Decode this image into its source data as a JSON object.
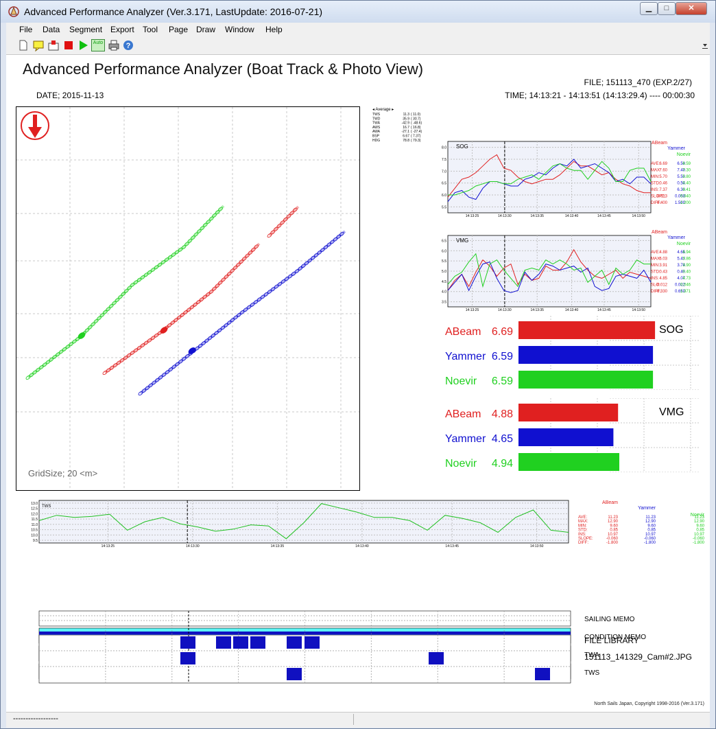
{
  "window": {
    "title": "Advanced Performance Analyzer (Ver.3.171, LastUpdate: 2016-07-21)",
    "minimize": "▁",
    "maximize": "□",
    "close": "✕"
  },
  "menu": [
    "File",
    "Data",
    "Segment",
    "Export",
    "Tool",
    "Page",
    "Draw",
    "Window",
    "Help"
  ],
  "toolbar": {
    "icons": [
      "new-file-icon",
      "memo-icon",
      "open-icon",
      "stop-icon",
      "play-icon",
      "auto-icon",
      "print-icon",
      "help-icon"
    ],
    "auto_label": "Auto"
  },
  "page": {
    "title": "Advanced Performance Analyzer (Boat Track & Photo View)",
    "file": "FILE; 151113_470 (EXP.2/27)",
    "date": "DATE; 2015-11-13",
    "time": "TIME; 14:13:21 - 14:13:51 (14:13:29.4) ---- 00:00:30",
    "copyright": "North Sails Japan, Copyright 1998-2016 (Ver.3.171)"
  },
  "track": {
    "grid_label": "GridSize; 20 <m>",
    "average": {
      "title": "◂ Average ▸",
      "rows": [
        {
          "name": "TWS",
          "v": "11.3",
          "p": "( 11.0)"
        },
        {
          "name": "TWD",
          "v": "35.9",
          "p": "( 30.7)"
        },
        {
          "name": "TWA",
          "v": "-42.9",
          "p": "( -48.6)"
        },
        {
          "name": "AWS",
          "v": "16.7",
          "p": "( 16.8)"
        },
        {
          "name": "AWA",
          "v": "-27.1",
          "p": "( -27.4)"
        },
        {
          "name": "BSP",
          "v": "6.67",
          "p": "( 7.37)"
        },
        {
          "name": "HDG",
          "v": "78.8",
          "p": "( 79.3)"
        }
      ]
    }
  },
  "colors": {
    "abeam": "#e02020",
    "yammer": "#1010d0",
    "noevir": "#20d020",
    "tws_line": "#20c020",
    "bar_cyan": "#5ef5f5",
    "bar_salmon": "#f07070",
    "bar_orange": "#f09060",
    "bar_navy": "#1010c0"
  },
  "boats": [
    "ABeam",
    "Yammer",
    "Noevir"
  ],
  "sog_chart": {
    "label": "SOG",
    "y_ticks": [
      "8.0",
      "7.5",
      "7.0",
      "6.5",
      "6.0",
      "5.5"
    ],
    "x_ticks": [
      "14:13:25",
      "14:13:30",
      "14:13:35",
      "14:13:40",
      "14:13:45",
      "14:13:50"
    ],
    "stats_labels": [
      "AVE:",
      "MAX:",
      "MIN:",
      "STD:",
      "INS:",
      "SLOPE:",
      "DIFF:"
    ],
    "stats": {
      "ABeam": [
        "6.69",
        "7.60",
        "5.70",
        "0.46",
        "7.37",
        "0.013",
        "0.400"
      ],
      "Yammer": [
        "6.59",
        "7.40",
        "5.50",
        "0.54",
        "6.30",
        "0.050",
        "1.500"
      ],
      "Noevir": [
        "6.59",
        "7.30",
        "5.80",
        "0.40",
        "6.41",
        "0.040",
        "1.200"
      ]
    }
  },
  "vmg_chart": {
    "label": "VMG",
    "y_ticks": [
      "6.5",
      "6.0",
      "5.5",
      "5.0",
      "4.5",
      "4.0",
      "3.5"
    ],
    "x_ticks": [
      "14:13:25",
      "14:13:30",
      "14:13:35",
      "14:13:40",
      "14:13:45",
      "14:13:50"
    ],
    "stats_labels": [
      "AVE:",
      "MAX:",
      "MIN:",
      "STD:",
      "INS:",
      "SLO:",
      "DIFF:"
    ],
    "stats": {
      "ABeam": [
        "4.88",
        "6.03",
        "3.91",
        "0.43",
        "4.85",
        "-0.012",
        "-0.330"
      ],
      "Yammer": [
        "4.65",
        "5.47",
        "3.74",
        "0.49",
        "4.07",
        "0.022",
        "0.650"
      ],
      "Noevir": [
        "4.94",
        "5.86",
        "3.90",
        "0.40",
        "4.73",
        "0.046",
        "1.371"
      ]
    }
  },
  "bar_panels": [
    {
      "title": "SOG",
      "rows": [
        {
          "boat": "ABeam",
          "value": "6.69"
        },
        {
          "boat": "Yammer",
          "value": "6.59"
        },
        {
          "boat": "Noevir",
          "value": "6.59"
        }
      ]
    },
    {
      "title": "VMG",
      "rows": [
        {
          "boat": "ABeam",
          "value": "4.88"
        },
        {
          "boat": "Yammer",
          "value": "4.65"
        },
        {
          "boat": "Noevir",
          "value": "4.94"
        }
      ]
    }
  ],
  "tws_chart": {
    "label": "TWS",
    "y_ticks": [
      "13.0",
      "12.5",
      "12.0",
      "11.5",
      "11.0",
      "10.5",
      "10.0",
      "9.5"
    ],
    "x_ticks": [
      "14:13:25",
      "14:13:30",
      "14:13:35",
      "14:13:40",
      "14:13:45",
      "14:13:50"
    ],
    "stats_labels": [
      "AVE:",
      "MAX:",
      "MIN:",
      "STD:",
      "INS:",
      "SLOPE:",
      "DIFF:"
    ],
    "stats": {
      "ABeam": [
        "11.23",
        "12.90",
        "9.60",
        "0.85",
        "10.97",
        "-0.060",
        "-1.800"
      ],
      "Yammer": [
        "11.23",
        "12.90",
        "9.60",
        "0.85",
        "10.97",
        "-0.060",
        "-1.800"
      ],
      "Noevir": [
        "11.23",
        "12.90",
        "9.60",
        "0.85",
        "10.97",
        "-0.060",
        "-1.800"
      ]
    }
  },
  "memo_labels": [
    "SAILING MEMO",
    "CONDITION MEMO",
    "TWA",
    "TWS"
  ],
  "library": {
    "title": "FILE LIBRARY",
    "file": "151113_141329_Cam#2.JPG"
  },
  "status": {
    "text": "------------------"
  },
  "chart_data": [
    {
      "type": "line",
      "title": "SOG",
      "x": [
        0,
        1,
        2,
        3,
        4,
        5,
        6,
        7,
        8,
        9,
        10,
        11,
        12,
        13,
        14,
        15,
        16,
        17,
        18,
        19,
        20,
        21,
        22,
        23,
        24,
        25,
        26,
        27,
        28,
        29
      ],
      "ylim": [
        5.0,
        8.2
      ],
      "x_ticks": [
        "14:13:25",
        "14:13:30",
        "14:13:35",
        "14:13:40",
        "14:13:45",
        "14:13:50"
      ],
      "series": [
        {
          "name": "ABeam",
          "values": [
            5.7,
            6.1,
            6.5,
            6.6,
            6.8,
            7.1,
            7.4,
            7.6,
            7.0,
            6.9,
            6.6,
            6.4,
            6.3,
            6.4,
            6.5,
            6.5,
            6.7,
            7.0,
            7.3,
            7.1,
            7.1,
            6.9,
            6.7,
            6.8,
            6.5,
            6.3,
            6.2,
            6.0,
            5.9,
            5.9
          ]
        },
        {
          "name": "Yammer",
          "values": [
            5.5,
            5.9,
            6.0,
            5.7,
            5.6,
            6.1,
            6.4,
            6.4,
            6.3,
            6.2,
            6.2,
            6.5,
            6.6,
            6.8,
            6.7,
            7.0,
            7.2,
            7.1,
            7.4,
            7.0,
            7.1,
            7.2,
            7.0,
            6.8,
            6.4,
            6.5,
            6.3,
            6.6,
            6.6,
            6.3
          ]
        },
        {
          "name": "Noevir",
          "values": [
            5.8,
            5.8,
            5.9,
            6.0,
            6.2,
            6.3,
            6.4,
            6.4,
            6.3,
            6.3,
            6.5,
            6.6,
            6.7,
            6.5,
            6.8,
            7.1,
            7.2,
            7.0,
            6.9,
            6.9,
            6.5,
            6.9,
            7.3,
            7.0,
            6.4,
            6.4,
            6.9,
            7.0,
            7.0,
            6.4
          ]
        }
      ]
    },
    {
      "type": "line",
      "title": "VMG",
      "x": [
        0,
        1,
        2,
        3,
        4,
        5,
        6,
        7,
        8,
        9,
        10,
        11,
        12,
        13,
        14,
        15,
        16,
        17,
        18,
        19,
        20,
        21,
        22,
        23,
        24,
        25,
        26,
        27,
        28,
        29
      ],
      "ylim": [
        3.2,
        6.7
      ],
      "x_ticks": [
        "14:13:25",
        "14:13:30",
        "14:13:35",
        "14:13:40",
        "14:13:45",
        "14:13:50"
      ],
      "series": [
        {
          "name": "ABeam",
          "values": [
            4.0,
            4.5,
            4.8,
            4.2,
            4.9,
            5.5,
            5.2,
            4.7,
            5.1,
            5.3,
            4.3,
            4.8,
            4.5,
            4.6,
            5.2,
            5.0,
            5.0,
            5.4,
            6.0,
            5.4,
            5.0,
            4.7,
            4.6,
            4.8,
            5.0,
            4.6,
            4.9,
            4.8,
            4.7,
            4.6
          ]
        },
        {
          "name": "Yammer",
          "values": [
            4.0,
            4.4,
            4.8,
            4.0,
            4.7,
            5.3,
            5.4,
            4.6,
            4.0,
            3.9,
            4.0,
            4.9,
            4.5,
            4.8,
            5.3,
            5.2,
            5.0,
            5.1,
            5.2,
            4.9,
            5.1,
            4.2,
            4.0,
            4.1,
            4.7,
            4.8,
            4.7,
            4.6,
            5.0,
            4.4
          ]
        },
        {
          "name": "Noevir",
          "values": [
            4.3,
            4.7,
            4.9,
            5.4,
            5.8,
            4.2,
            5.3,
            5.5,
            5.0,
            4.6,
            4.2,
            5.0,
            5.1,
            5.0,
            5.5,
            5.3,
            5.5,
            5.3,
            5.0,
            5.1,
            4.4,
            4.7,
            5.0,
            4.3,
            5.1,
            4.8,
            5.0,
            5.5,
            5.3,
            5.3
          ]
        }
      ]
    },
    {
      "type": "line",
      "title": "TWS",
      "x": [
        0,
        1,
        2,
        3,
        4,
        5,
        6,
        7,
        8,
        9,
        10,
        11,
        12,
        13,
        14,
        15,
        16,
        17,
        18,
        19,
        20,
        21,
        22,
        23,
        24,
        25,
        26,
        27,
        28,
        29,
        30
      ],
      "ylim": [
        9.2,
        13.2
      ],
      "x_ticks": [
        "14:13:25",
        "14:13:30",
        "14:13:35",
        "14:13:40",
        "14:13:45",
        "14:13:50"
      ],
      "series": [
        {
          "name": "TWS",
          "values": [
            11.3,
            11.8,
            11.6,
            11.7,
            11.9,
            10.4,
            11.2,
            11.6,
            11.0,
            10.7,
            10.3,
            10.5,
            10.9,
            10.8,
            9.6,
            11.1,
            12.9,
            12.5,
            12.1,
            11.6,
            11.6,
            11.3,
            10.4,
            11.8,
            11.5,
            11.1,
            10.2,
            11.6,
            12.3,
            10.4,
            10.2
          ]
        }
      ]
    },
    {
      "type": "bar",
      "title": "SOG",
      "categories": [
        "ABeam",
        "Yammer",
        "Noevir"
      ],
      "values": [
        6.69,
        6.59,
        6.59
      ]
    },
    {
      "type": "bar",
      "title": "VMG",
      "categories": [
        "ABeam",
        "Yammer",
        "Noevir"
      ],
      "values": [
        4.88,
        4.65,
        4.94
      ]
    }
  ]
}
